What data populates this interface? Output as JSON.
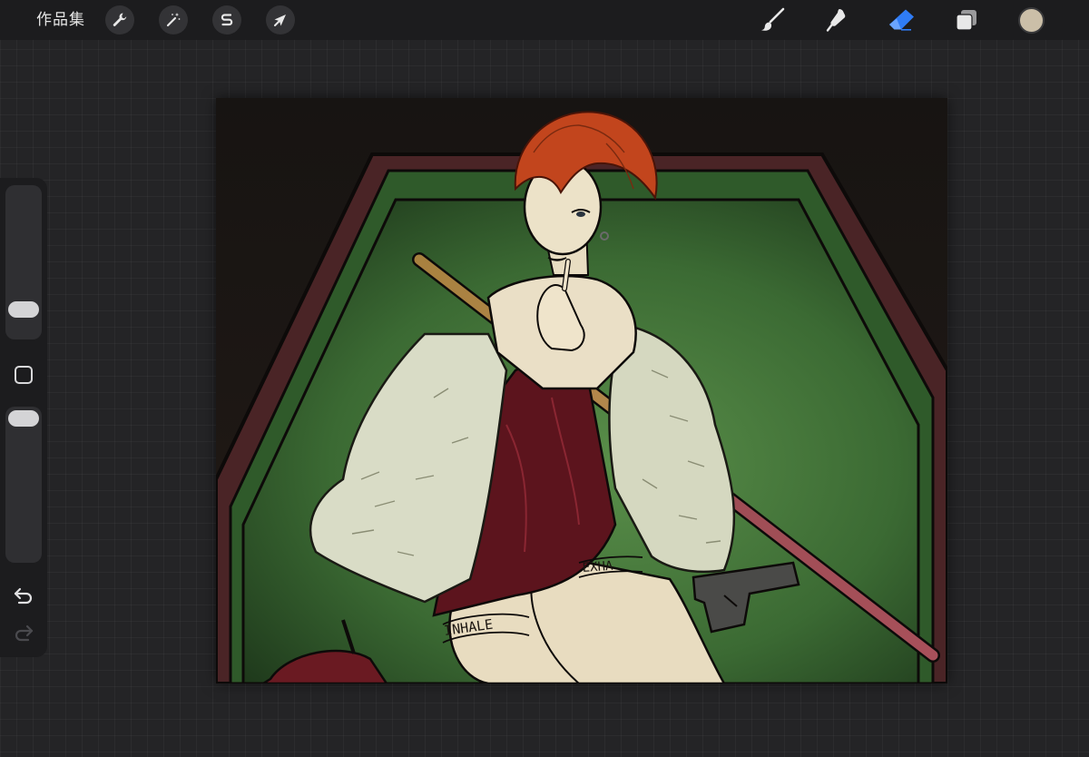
{
  "app": {
    "gallery_label": "作品集"
  },
  "toolbar_left": [
    {
      "name": "actions-icon",
      "label": "wrench"
    },
    {
      "name": "adjustments-icon",
      "label": "magic-wand"
    },
    {
      "name": "selection-icon",
      "label": "selection-s"
    },
    {
      "name": "transform-icon",
      "label": "arrow-cursor"
    }
  ],
  "toolbar_right": [
    {
      "name": "brush-icon",
      "active": false
    },
    {
      "name": "smudge-icon",
      "active": false
    },
    {
      "name": "eraser-icon",
      "active": true
    },
    {
      "name": "layers-icon",
      "active": false
    }
  ],
  "colors": {
    "current_color": "#cbbfa8",
    "accent_active": "#2f7cf6",
    "toolbar_bg": "#1c1c1e",
    "workspace_bg": "#242426"
  },
  "sidebar": {
    "brush_size_level": 0.78,
    "opacity_level": 0.03
  },
  "artwork": {
    "text_tattoo_left": "INHALE",
    "text_tattoo_right": "EXHA"
  }
}
